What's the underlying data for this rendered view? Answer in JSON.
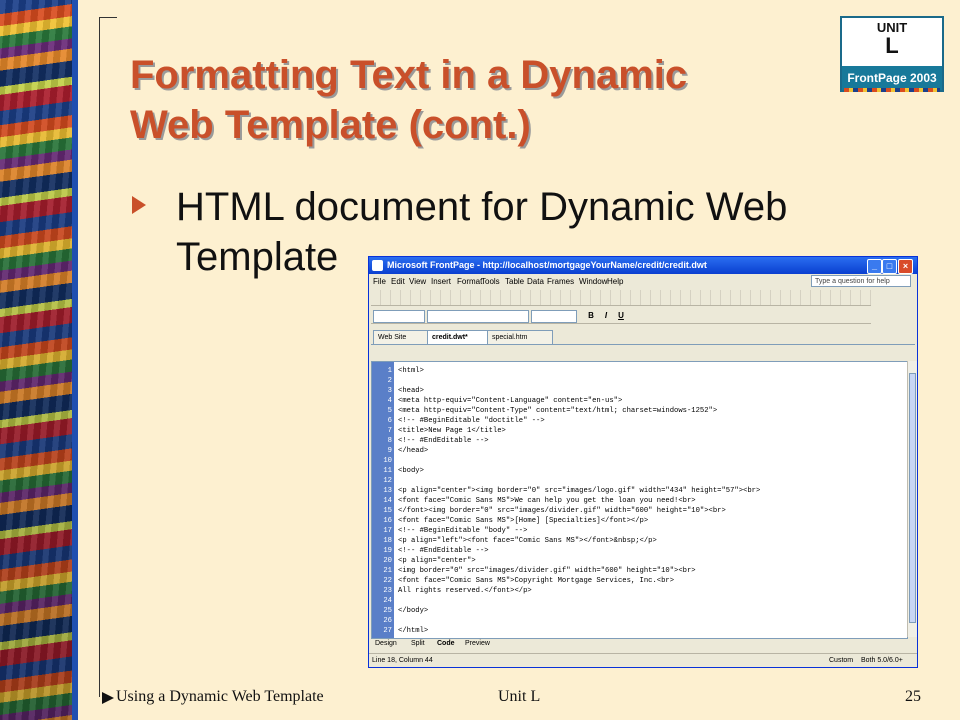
{
  "slide": {
    "title_line1": "Formatting Text in a Dynamic",
    "title_line2": "Web Template (cont.)",
    "bullet": "HTML document for Dynamic Web Template",
    "logo": {
      "unit_word": "UNIT",
      "unit_letter": "L",
      "product": "FrontPage 2003"
    },
    "footer": {
      "left": "Using a Dynamic Web Template",
      "middle": "Unit L",
      "page": "25"
    },
    "colors": {
      "title": "#c9502a",
      "background": "#fdf0d0"
    }
  },
  "screenshot": {
    "window_title": "Microsoft FrontPage - http://localhost/mortgageYourName/credit/credit.dwt",
    "menu": [
      "File",
      "Edit",
      "View",
      "Insert",
      "Format",
      "Tools",
      "Table",
      "Data",
      "Frames",
      "Window",
      "Help"
    ],
    "help_placeholder": "Type a question for help",
    "toolbar_format_buttons": [
      "B",
      "I",
      "U"
    ],
    "tabs": [
      "Web Site",
      "credit.dwt*",
      "special.htm"
    ],
    "code_lines": [
      "<html>",
      "",
      "<head>",
      "<meta http-equiv=\"Content-Language\" content=\"en-us\">",
      "<meta http-equiv=\"Content-Type\" content=\"text/html; charset=windows-1252\">",
      "<!-- #BeginEditable \"doctitle\" -->",
      "<title>New Page 1</title>",
      "<!-- #EndEditable -->",
      "</head>",
      "",
      "<body>",
      "",
      "<p align=\"center\"><img border=\"0\" src=\"images/logo.gif\" width=\"434\" height=\"57\"><br>",
      "<font face=\"Comic Sans MS\">We can help you get the loan you need!<br>",
      "</font><img border=\"0\" src=\"images/divider.gif\" width=\"600\" height=\"10\"><br>",
      "<font face=\"Comic Sans MS\">[Home] [Specialties]</font></p>",
      "<!-- #BeginEditable \"body\" -->",
      "<p align=\"left\"><font face=\"Comic Sans MS\"></font>&nbsp;</p>",
      "<!-- #EndEditable -->",
      "<p align=\"center\">",
      "<img border=\"0\" src=\"images/divider.gif\" width=\"600\" height=\"10\"><br>",
      "<font face=\"Comic Sans MS\">Copyright Mortgage Services, Inc.<br>",
      "All rights reserved.</font></p>",
      "",
      "</body>",
      "",
      "</html>"
    ],
    "view_tabs": [
      "Design",
      "Split",
      "Code",
      "Preview"
    ],
    "status": {
      "position": "Line 18, Column 44",
      "mode": "Custom",
      "browser": "Both 5.0/6.0+"
    }
  }
}
